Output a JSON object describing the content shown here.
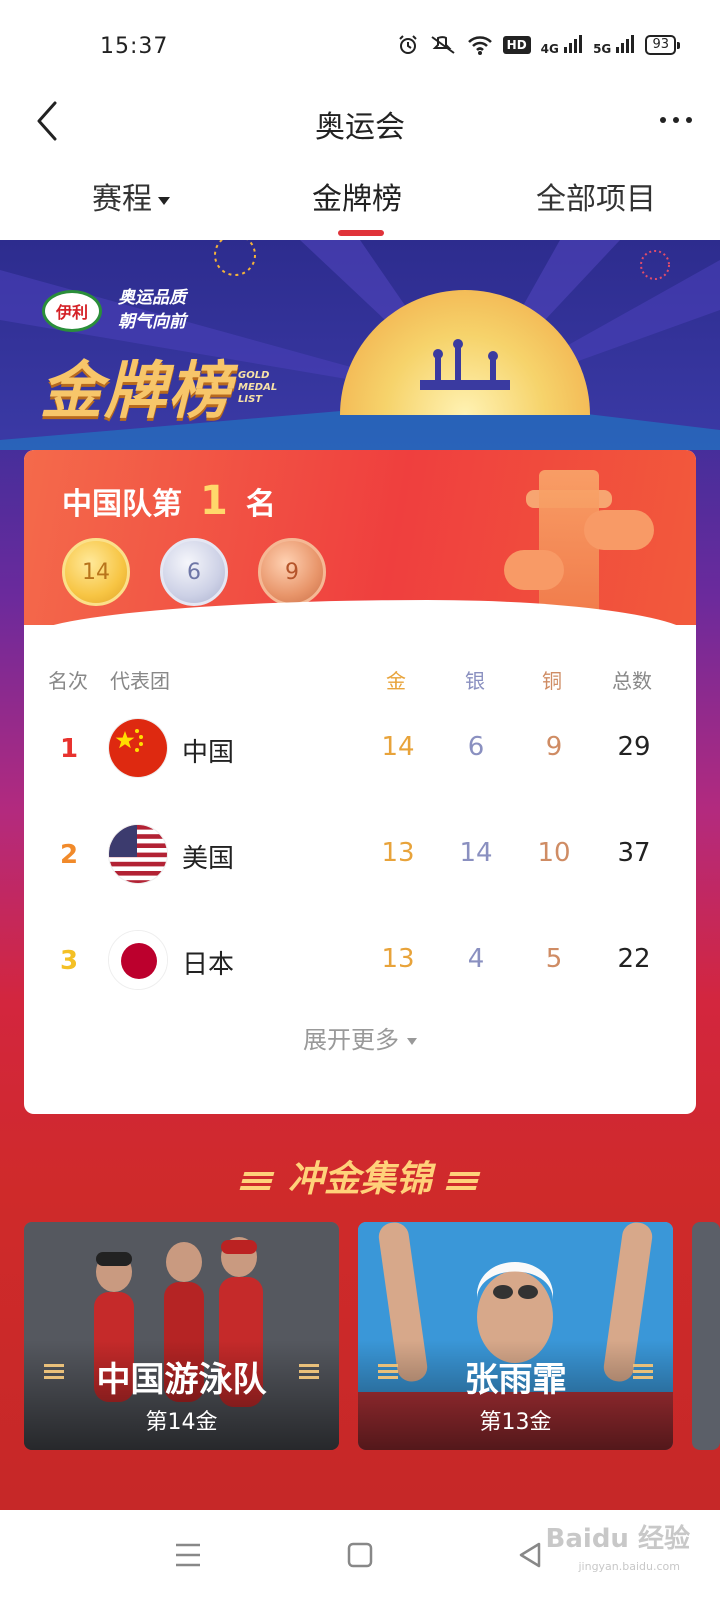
{
  "status_bar": {
    "time": "15:37",
    "icons": [
      "alarm-icon",
      "mute-icon",
      "wifi-icon",
      "hd-icon",
      "signal-4g-icon",
      "signal-5g-icon"
    ],
    "hd": "HD",
    "net1": "4G",
    "net2": "5G",
    "battery": "93"
  },
  "header": {
    "title": "奥运会"
  },
  "tabs": [
    {
      "label": "赛程"
    },
    {
      "label": "金牌榜"
    },
    {
      "label": "全部项目"
    }
  ],
  "banner": {
    "brand": "伊利",
    "slogan_line1": "奥运品质",
    "slogan_line2": "朝气向前",
    "title": "金牌榜",
    "sub_line1": "GOLD",
    "sub_line2": "MEDAL",
    "sub_line3": "LIST"
  },
  "summary": {
    "prefix": "中国队第",
    "rank": "1",
    "suffix": "名",
    "gold": "14",
    "silver": "6",
    "bronze": "9"
  },
  "table": {
    "headers": {
      "rank": "名次",
      "team": "代表团",
      "gold": "金",
      "silver": "银",
      "bronze": "铜",
      "total": "总数"
    },
    "rows": [
      {
        "rank": "1",
        "country": "中国",
        "gold": "14",
        "silver": "6",
        "bronze": "9",
        "total": "29"
      },
      {
        "rank": "2",
        "country": "美国",
        "gold": "13",
        "silver": "14",
        "bronze": "10",
        "total": "37"
      },
      {
        "rank": "3",
        "country": "日本",
        "gold": "13",
        "silver": "4",
        "bronze": "5",
        "total": "22"
      }
    ],
    "expand_label": "展开更多"
  },
  "highlights": {
    "title": "冲金集锦",
    "items": [
      {
        "name": "中国游泳队",
        "sub": "第14金"
      },
      {
        "name": "张雨霏",
        "sub": "第13金"
      }
    ]
  },
  "watermark": {
    "text": "Baidu 经验",
    "sub": "jingyan.baidu.com"
  },
  "colors": {
    "accent": "#e0333a",
    "gold": "#e8a33a",
    "silver": "#8a90c0",
    "bronze": "#cf8c64"
  }
}
